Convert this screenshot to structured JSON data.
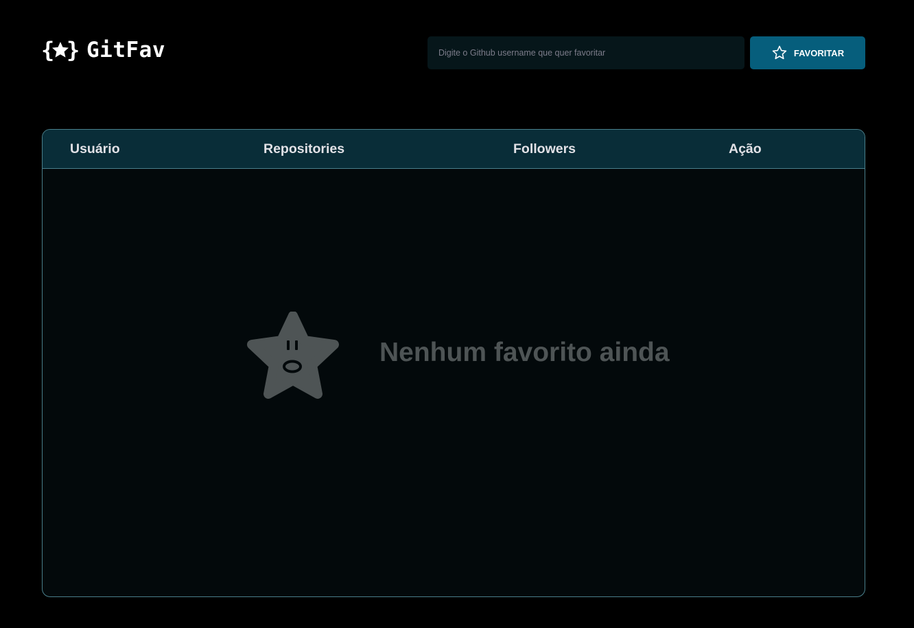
{
  "header": {
    "logo_text": "GitFav",
    "logo_icon": "braces-star-icon",
    "search": {
      "placeholder": "Digite o Github username que quer favoritar",
      "value": ""
    },
    "favorite_button": {
      "label": "FAVORITAR",
      "icon": "star-outline-icon"
    }
  },
  "table": {
    "columns": [
      "Usuário",
      "Repositories",
      "Followers",
      "Ação"
    ],
    "rows": [],
    "empty_state": {
      "message": "Nenhum favorito ainda",
      "icon": "surprised-star-icon"
    }
  },
  "colors": {
    "background": "#000000",
    "accent": "#065e7c",
    "table_header": "#092d38",
    "table_border": "#4a808c",
    "table_body": "#03090b",
    "muted_text": "#4e5455"
  }
}
